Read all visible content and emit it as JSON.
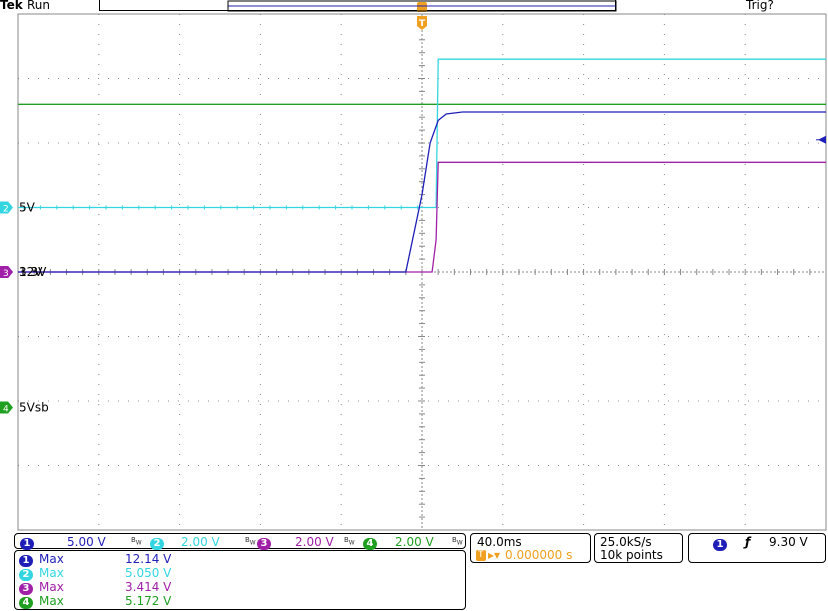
{
  "topbar": {
    "brand": "Tek",
    "run_state": "Run",
    "trigger_state": "Trig?"
  },
  "channels": [
    {
      "id": "1",
      "marker": "12V",
      "scale": "5.00 V",
      "color": "#1f1fb8"
    },
    {
      "id": "2",
      "marker": "5V",
      "scale": "2.00 V",
      "color": "#33d6e0"
    },
    {
      "id": "3",
      "marker": "3.3V",
      "scale": "2.00 V",
      "color": "#a020a8"
    },
    {
      "id": "4",
      "marker": "5Vsb",
      "scale": "2.00 V",
      "color": "#20a020"
    }
  ],
  "timebase": {
    "scale": "40.0ms",
    "delay": "0.000000 s",
    "sample_rate": "25.0kS/s",
    "record_length": "10k points"
  },
  "trigger": {
    "source": "1",
    "level": "9.30 V"
  },
  "measurements": [
    {
      "ch": "1",
      "label": "Max",
      "value": "12.14 V"
    },
    {
      "ch": "2",
      "label": "Max",
      "value": "5.050 V"
    },
    {
      "ch": "3",
      "label": "Max",
      "value": "3.414 V"
    },
    {
      "ch": "4",
      "label": "Max",
      "value": "5.172 V"
    }
  ],
  "chart_data": {
    "type": "line",
    "x_unit": "ms",
    "y_unit": "divisions",
    "xlim": [
      -200,
      200
    ],
    "ylim": [
      -4,
      4
    ],
    "grid": true,
    "series": [
      {
        "name": "1",
        "x": [
          -200,
          -8,
          0,
          4,
          8,
          12,
          20,
          200
        ],
        "y": [
          0,
          0,
          1.2,
          2,
          2.35,
          2.45,
          2.48,
          2.48
        ]
      },
      {
        "name": "2",
        "x": [
          -200,
          4,
          7,
          8,
          200
        ],
        "y": [
          1.0,
          1.0,
          1.0,
          3.3,
          3.3
        ]
      },
      {
        "name": "3",
        "x": [
          -200,
          5,
          7,
          8,
          200
        ],
        "y": [
          0,
          0,
          0.5,
          1.7,
          1.7
        ]
      },
      {
        "name": "4",
        "x": [
          -200,
          200
        ],
        "y": [
          2.6,
          2.6
        ]
      }
    ]
  }
}
